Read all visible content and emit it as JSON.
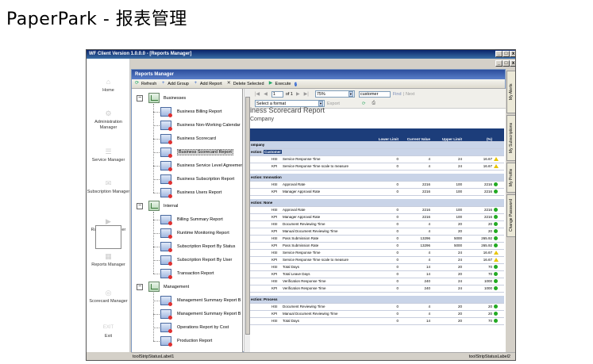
{
  "page_header": "PaperPark - 报表管理",
  "window": {
    "title": "WF Client Version 1.0.0.0 - [Reports Manager]",
    "controls": {
      "minimize": "_",
      "maximize": "□",
      "close": "x"
    }
  },
  "left_nav": [
    {
      "label": "Home",
      "icon": "home-icon"
    },
    {
      "label": "Administration Manager",
      "icon": "admin-icon"
    },
    {
      "label": "Service Manager",
      "icon": "service-icon"
    },
    {
      "label": "Subscription Manager",
      "icon": "subscription-icon"
    },
    {
      "label": "Runtime Manager",
      "icon": "runtime-icon"
    },
    {
      "label": "Reports Manager",
      "icon": "reports-icon"
    },
    {
      "label": "Scorecard Manager",
      "icon": "scorecard-icon"
    },
    {
      "label": "Exit",
      "icon_text": "EXIT",
      "icon": "exit-icon"
    }
  ],
  "reports_manager": {
    "title": "Reports Manager",
    "toolbar": [
      "Refresh",
      "Add Group",
      "Add Report",
      "Delete Selected",
      "Execute"
    ],
    "tree": [
      {
        "label": "Businesses",
        "level": 0,
        "expander": "−"
      },
      {
        "label": "Business Billing Report",
        "level": 1
      },
      {
        "label": "Business Non-Working Calendar",
        "level": 1
      },
      {
        "label": "Business Scorecard",
        "level": 1
      },
      {
        "label": "Business Scorecard Report",
        "level": 1,
        "selected": true
      },
      {
        "label": "Business Service Level Agreement",
        "level": 1
      },
      {
        "label": "Business Subscription Report",
        "level": 1
      },
      {
        "label": "Business Users Report",
        "level": 1
      },
      {
        "label": "Internal",
        "level": 0,
        "expander": "−"
      },
      {
        "label": "Billing Summary Report",
        "level": 1
      },
      {
        "label": "Runtime Monitoring Report",
        "level": 1
      },
      {
        "label": "Subscription Report By Status",
        "level": 1
      },
      {
        "label": "Subscription Report By User",
        "level": 1
      },
      {
        "label": "Transaction Report",
        "level": 1
      },
      {
        "label": "Management",
        "level": 0,
        "expander": "−"
      },
      {
        "label": "Management Summary Report B",
        "level": 1
      },
      {
        "label": "Management Summary Report B",
        "level": 1
      },
      {
        "label": "Operations Report by Cost",
        "level": 1
      },
      {
        "label": "Production Report",
        "level": 1
      }
    ]
  },
  "viewer": {
    "page_value": "1",
    "page_of": "of 1",
    "zoom": "75%",
    "search_value": "customer",
    "find_label": "Find",
    "separator": "|",
    "next_label": "Next",
    "format_placeholder": "Select a format",
    "export_label": "Export",
    "report_title": "iness Scorecard Report",
    "report_subtitle": "Company",
    "columns": [
      "",
      "",
      "",
      "Lower Limit",
      "Current Value",
      "Upper Limit",
      "(%)",
      ""
    ],
    "company_label": "ompany",
    "sections": [
      {
        "label": "ection: ",
        "name": "Customer",
        "highlight": true,
        "rows": [
          [
            "",
            "HSI",
            "Service Response Time",
            "0",
            "4",
            "24",
            "16.67",
            "warn"
          ],
          [
            "",
            "KPI",
            "Service Response Time scale to measure",
            "0",
            "4",
            "24",
            "16.67",
            "warn"
          ]
        ]
      },
      {
        "label": "ection: ",
        "name": "Innovation",
        "highlight": false,
        "rows": [
          [
            "",
            "HSI",
            "Approval Rate",
            "0",
            "2216",
            "100",
            "2216",
            "ok"
          ],
          [
            "",
            "KPI",
            "Manager Approval Rate",
            "0",
            "2216",
            "100",
            "2216",
            "ok"
          ]
        ]
      },
      {
        "label": "ection: ",
        "name": "None",
        "highlight": false,
        "rows": [
          [
            "",
            "HSI",
            "Approval Rate",
            "0",
            "2216",
            "100",
            "2216",
            "ok"
          ],
          [
            "",
            "KPI",
            "Manager Approval Rate",
            "0",
            "2216",
            "100",
            "2216",
            "ok"
          ],
          [
            "",
            "HSI",
            "Document Reviewing Time",
            "0",
            "4",
            "20",
            "20",
            "ok"
          ],
          [
            "",
            "KPI",
            "Manual Document Reviewing Time",
            "0",
            "4",
            "20",
            "20",
            "ok"
          ],
          [
            "",
            "HSI",
            "Pass Submission Rate",
            "0",
            "13296",
            "5000",
            "265.92",
            "ok"
          ],
          [
            "",
            "KPI",
            "Pass Submission Rate",
            "0",
            "13296",
            "5000",
            "265.92",
            "ok"
          ],
          [
            "",
            "HSI",
            "Service Response Time",
            "0",
            "4",
            "24",
            "16.67",
            "warn"
          ],
          [
            "",
            "KPI",
            "Service Response Time scale to measure",
            "0",
            "4",
            "24",
            "16.67",
            "warn"
          ],
          [
            "",
            "HSI",
            "Total Days",
            "0",
            "14",
            "20",
            "70",
            "ok"
          ],
          [
            "",
            "KPI",
            "Total Leave Days",
            "0",
            "14",
            "20",
            "70",
            "ok"
          ],
          [
            "",
            "HSI",
            "Verification Response Time",
            "0",
            "240",
            "24",
            "1000",
            "ok"
          ],
          [
            "",
            "KPI",
            "Verification Response Time",
            "0",
            "240",
            "24",
            "1000",
            "ok"
          ]
        ]
      },
      {
        "label": "ection: ",
        "name": "Process",
        "highlight": false,
        "rows": [
          [
            "",
            "HSI",
            "Document Reviewing Time",
            "0",
            "4",
            "20",
            "20",
            "ok"
          ],
          [
            "",
            "KPI",
            "Manual Document Reviewing Time",
            "0",
            "4",
            "20",
            "20",
            "ok"
          ],
          [
            "",
            "HSI",
            "Total Days",
            "0",
            "14",
            "20",
            "70",
            "ok"
          ]
        ]
      }
    ]
  },
  "right_tabs": [
    "My Alerts",
    "My Subscriptions",
    "My Profile",
    "Change Password"
  ],
  "status_bar": {
    "left": "toolStripStatusLabel1",
    "right": "toolStripStatusLabel2"
  },
  "colors": {
    "ok": "#22aa22",
    "warn": "#e8c400",
    "header": "#1c3d7a"
  }
}
